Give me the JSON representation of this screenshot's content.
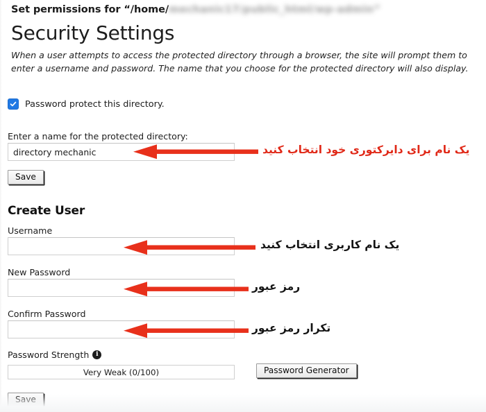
{
  "header": {
    "prefix": "Set permissions for “/home/",
    "redacted_path": "mechanic17/public_html/wp-admin”"
  },
  "page_title": "Security Settings",
  "description": "When a user attempts to access the protected directory through a browser, the site will prompt them to enter a username and password. The name that you choose for the protected directory will also display.",
  "protect": {
    "checkbox_label": "Password protect this directory.",
    "checkbox_checked": true,
    "directory_name_label": "Enter a name for the protected directory:",
    "directory_name_value": "directory mechanic",
    "directory_name_placeholder": "",
    "save_label": "Save"
  },
  "create_user": {
    "section_title": "Create User",
    "username_label": "Username",
    "username_value": "",
    "username_placeholder": "",
    "new_password_label": "New Password",
    "new_password_value": "",
    "new_password_placeholder": "",
    "confirm_password_label": "Confirm Password",
    "confirm_password_value": "",
    "confirm_password_placeholder": "",
    "password_strength_label": "Password Strength",
    "info_icon_glyph": "i",
    "password_strength_value": "Very Weak (0/100)",
    "password_generator_label": "Password Generator",
    "save_label": "Save"
  },
  "annotations": [
    {
      "text": "یک نام برای دایرکتوری خود انتخاب کنید",
      "color": "#e02817"
    },
    {
      "text": "یک نام کاربری انتخاب کنید",
      "color": "#131313"
    },
    {
      "text": "رمز عبور",
      "color": "#131313"
    },
    {
      "text": "تکرار رمز عبور",
      "color": "#131313"
    }
  ],
  "colors": {
    "checkbox_blue": "#2079e4",
    "arrow_red": "#e8301b",
    "annotation_red": "#e02817",
    "text": "#1c1c1c",
    "input_border": "#cfcfcf"
  }
}
